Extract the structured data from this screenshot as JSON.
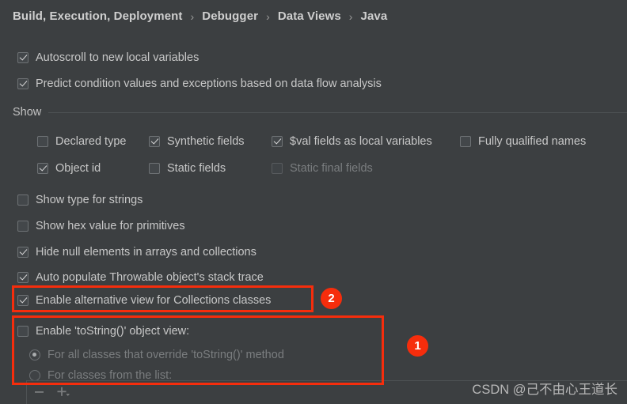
{
  "breadcrumb": {
    "separator": "›",
    "items": [
      {
        "label": "Build, Execution, Deployment"
      },
      {
        "label": "Debugger"
      },
      {
        "label": "Data Views"
      },
      {
        "label": "Java"
      }
    ]
  },
  "top_options": [
    {
      "label": "Autoscroll to new local variables",
      "checked": true
    },
    {
      "label": "Predict condition values and exceptions based on data flow analysis",
      "checked": true
    }
  ],
  "show_section": {
    "title": "Show",
    "grid": [
      {
        "label": "Declared type",
        "checked": false,
        "enabled": true
      },
      {
        "label": "Synthetic fields",
        "checked": true,
        "enabled": true
      },
      {
        "label": "$val fields as local variables",
        "checked": true,
        "enabled": true
      },
      {
        "label": "Fully qualified names",
        "checked": false,
        "enabled": true
      },
      {
        "label": "Object id",
        "checked": true,
        "enabled": true
      },
      {
        "label": "Static fields",
        "checked": false,
        "enabled": true
      },
      {
        "label": "Static final fields",
        "checked": false,
        "enabled": false
      }
    ]
  },
  "middle_options": [
    {
      "label": "Show type for strings",
      "checked": false
    },
    {
      "label": "Show hex value for primitives",
      "checked": false
    },
    {
      "label": "Hide null elements in arrays and collections",
      "checked": true
    },
    {
      "label": "Auto populate Throwable object's stack trace",
      "checked": true
    },
    {
      "label": "Enable alternative view for Collections classes",
      "checked": true
    }
  ],
  "tostring_section": {
    "enable_label": "Enable 'toString()' object view:",
    "enable_checked": false,
    "radios": [
      {
        "label": "For all classes that override 'toString()' method",
        "selected": true,
        "enabled": false
      },
      {
        "label": "For classes from the list:",
        "selected": false,
        "enabled": false
      }
    ]
  },
  "list_toolbar": {
    "remove_icon": "minus-icon",
    "add_icon": "plus-dropdown-icon"
  },
  "annotations": [
    {
      "id": "1",
      "target": "tostring-section"
    },
    {
      "id": "2",
      "target": "collections-row"
    }
  ],
  "watermark": {
    "text": "CSDN @己不由心王道长"
  },
  "colors": {
    "background": "#3c3f41",
    "text": "#c8c8c8",
    "text_disabled": "#7a7d7f",
    "annotation_red": "#f62d0c",
    "separator": "#4e5254"
  }
}
